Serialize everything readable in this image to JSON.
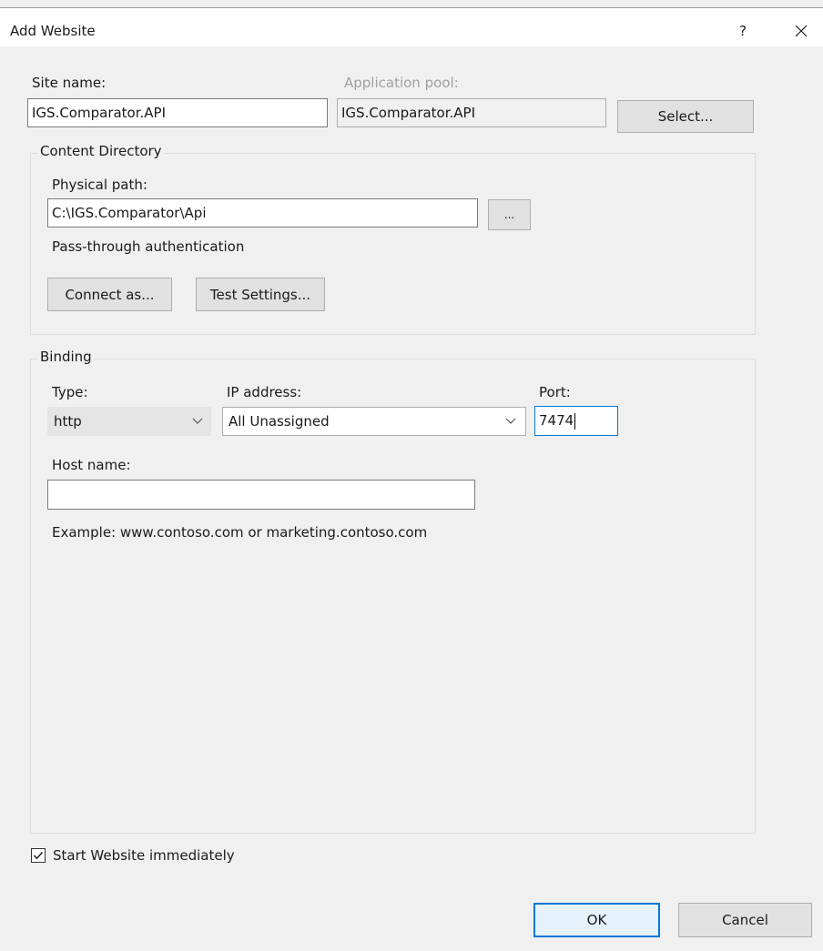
{
  "window": {
    "title": "Add Website",
    "help_label": "?"
  },
  "site": {
    "name_label": "Site name:",
    "name_value": "IGS.Comparator.API",
    "pool_label": "Application pool:",
    "pool_value": "IGS.Comparator.API",
    "select_label": "Select..."
  },
  "content": {
    "group_title": "Content Directory",
    "path_label": "Physical path:",
    "path_value": "C:\\IGS.Comparator\\Api",
    "browse_label": "...",
    "auth_label": "Pass-through authentication",
    "connect_label": "Connect as...",
    "test_label": "Test Settings..."
  },
  "binding": {
    "group_title": "Binding",
    "type_label": "Type:",
    "type_value": "http",
    "ip_label": "IP address:",
    "ip_value": "All Unassigned",
    "port_label": "Port:",
    "port_value": "7474",
    "host_label": "Host name:",
    "host_value": "",
    "example_text": "Example: www.contoso.com or marketing.contoso.com"
  },
  "footer": {
    "start_label": "Start Website immediately",
    "start_checked": true,
    "ok_label": "OK",
    "cancel_label": "Cancel"
  },
  "icons": {
    "close": "close-icon",
    "chevron": "chevron-down-icon",
    "check": "checkmark-icon"
  },
  "colors": {
    "focus_accent": "#0078d7"
  }
}
